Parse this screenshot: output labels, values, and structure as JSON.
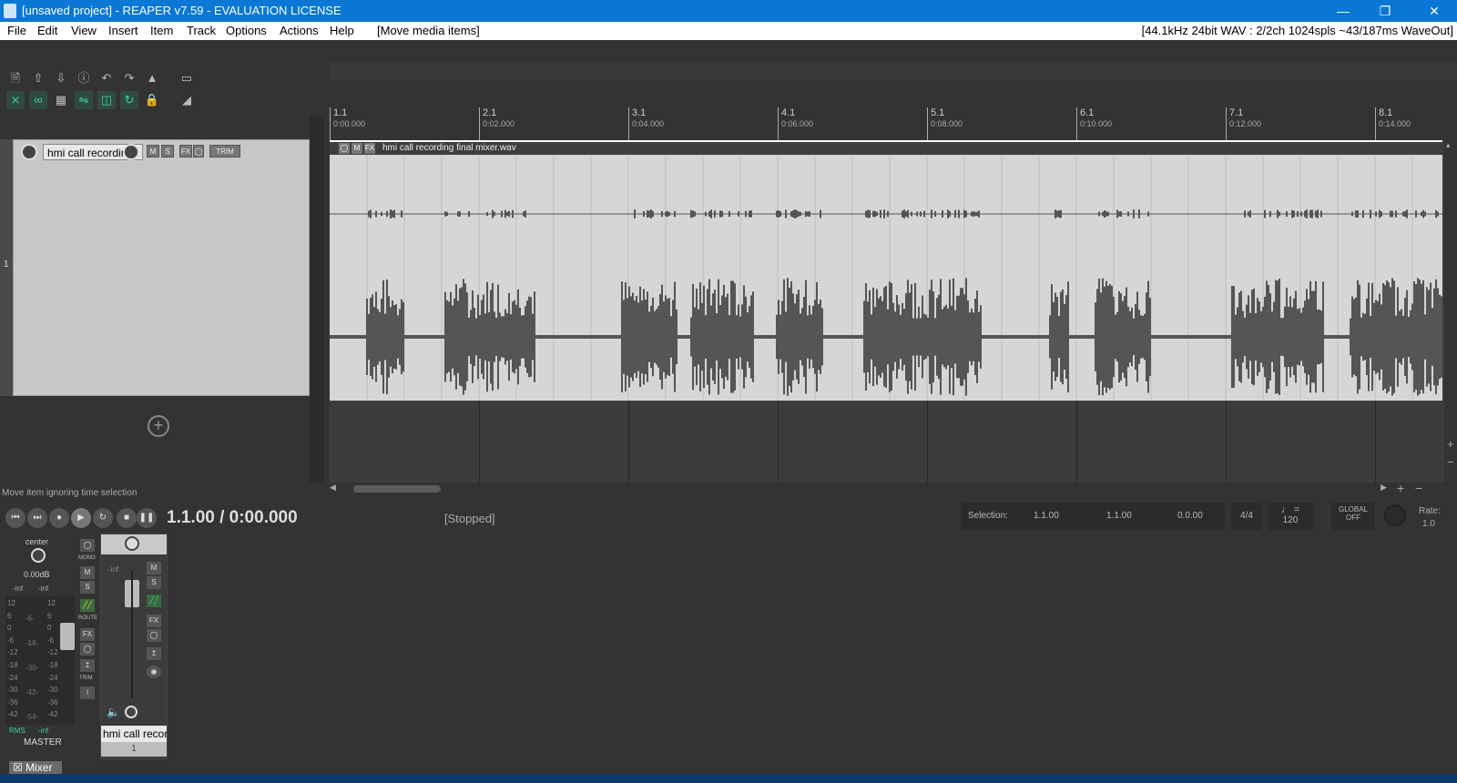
{
  "window": {
    "title": "[unsaved project] - REAPER v7.59 - EVALUATION LICENSE",
    "controls": {
      "minimize": "—",
      "restore": "❐",
      "close": "✕"
    }
  },
  "menu": {
    "items": [
      "File",
      "Edit",
      "View",
      "Insert",
      "Item",
      "Track",
      "Options",
      "Actions",
      "Help"
    ],
    "action_hint": "[Move media items]",
    "audio_status": "[44.1kHz 24bit WAV : 2/2ch 1024spls ~43/187ms WaveOut]"
  },
  "ruler": {
    "marks": [
      {
        "bar": "1.1",
        "time": "0:00.000"
      },
      {
        "bar": "2.1",
        "time": "0:02.000"
      },
      {
        "bar": "3.1",
        "time": "0:04.000"
      },
      {
        "bar": "4.1",
        "time": "0:06.000"
      },
      {
        "bar": "5.1",
        "time": "0:08.000"
      },
      {
        "bar": "6.1",
        "time": "0:10.000"
      },
      {
        "bar": "7.1",
        "time": "0:12.000"
      },
      {
        "bar": "8.1",
        "time": "0:14.000"
      }
    ]
  },
  "track": {
    "number": "1",
    "name": "hmi call recording",
    "buttons": {
      "mute": "M",
      "solo": "S",
      "fx": "FX",
      "trim": "TRIM"
    }
  },
  "media_item": {
    "name": "hmi call recording final mixer.wav",
    "buttons": {
      "mute": "M",
      "fx": "FX"
    }
  },
  "hint": "Move item ignoring time selection",
  "transport": {
    "timecode": "1.1.00 / 0:00.000",
    "state": "[Stopped]",
    "selection_label": "Selection:",
    "selection_start": "1.1.00",
    "selection_end": "1.1.00",
    "selection_length": "0.0.00",
    "time_signature": "4/4",
    "bpm": "120",
    "global_label": "GLOBAL",
    "global_state": "OFF",
    "rate_label": "Rate:",
    "rate_value": "1.0"
  },
  "mixer": {
    "master": {
      "pan": "center",
      "volume": "0.00dB",
      "peak_left": "-inf",
      "peak_right": "-inf",
      "rms_label": "RMS",
      "rms_value": "-inf",
      "label": "MASTER",
      "scale": [
        "12",
        "6",
        "0",
        "-6",
        "-12",
        "-18",
        "-24",
        "-30",
        "-36",
        "-42"
      ],
      "inner_scale": [
        "-6-",
        "-18-",
        "-30-",
        "-42-",
        "-54-"
      ],
      "buttons": {
        "mono": "MONO",
        "mute": "M",
        "solo": "S",
        "route": "ROUTE",
        "fx": "FX",
        "trim": "TRIM",
        "info": "i"
      }
    },
    "track": {
      "name": "hmi call recor",
      "number": "1",
      "peak": "-inf",
      "buttons": {
        "mute": "M",
        "solo": "S",
        "fx": "FX"
      }
    },
    "tab_label": "Mixer"
  },
  "colors": {
    "titlebar": "#0a78d4",
    "background": "#333333",
    "item_background": "#d6d6d6",
    "waveform": "#555555",
    "accent_green": "#3ecf9a"
  }
}
